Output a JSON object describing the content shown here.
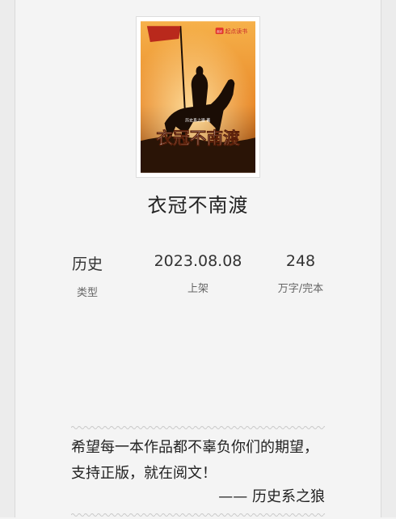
{
  "cover": {
    "brand_text": "起点读书",
    "brand_badge": "起点",
    "author_text": "历史系之狼 著",
    "title_text": "衣冠不南渡"
  },
  "book": {
    "title": "衣冠不南渡"
  },
  "stats": [
    {
      "value": "历史",
      "label": "类型"
    },
    {
      "value": "2023.08.08",
      "label": "上架"
    },
    {
      "value": "248",
      "label": "万字/完本"
    }
  ],
  "message": {
    "text": "希望每一本作品都不辜负你们的期望，支持正版，就在阅文！",
    "signature": "—— 历史系之狼"
  }
}
